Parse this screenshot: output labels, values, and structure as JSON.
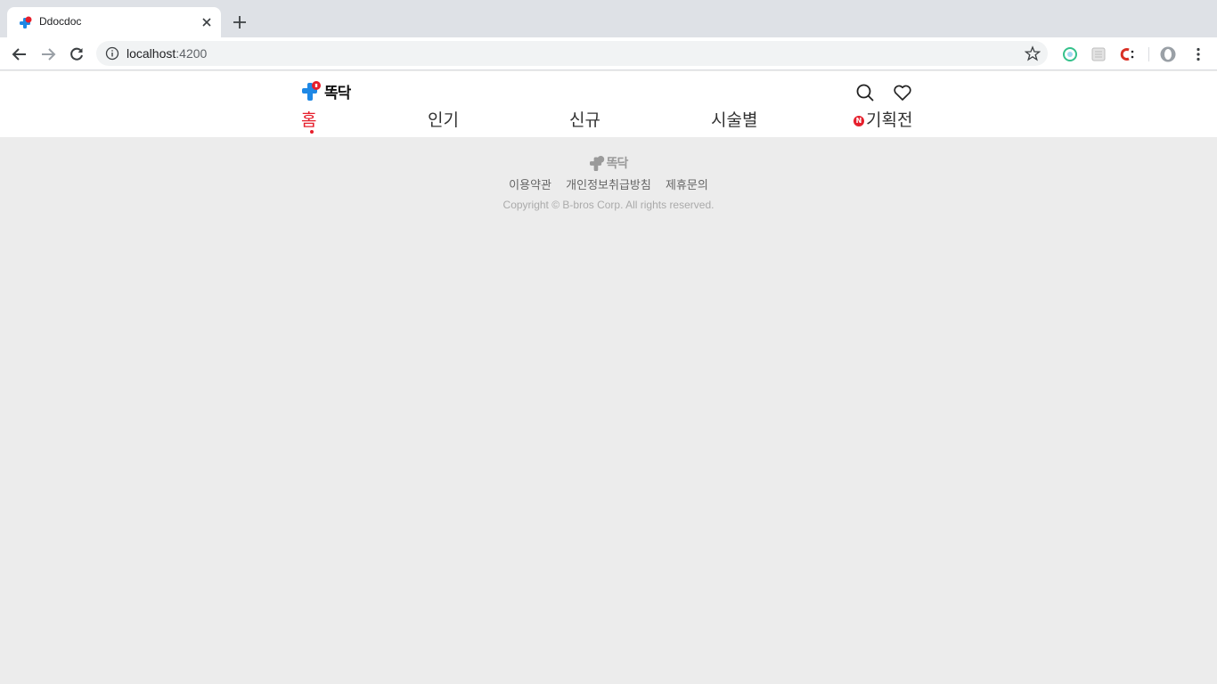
{
  "browser": {
    "tab_title": "Ddocdoc",
    "url_host": "localhost",
    "url_port": ":4200"
  },
  "site": {
    "logo_text": "똑닥",
    "menu": [
      {
        "label": "홈",
        "active": true
      },
      {
        "label": "인기",
        "active": false
      },
      {
        "label": "신규",
        "active": false
      },
      {
        "label": "시술별",
        "active": false
      },
      {
        "label": "기획전",
        "active": false,
        "badge": "N"
      }
    ],
    "icons": [
      "search-icon",
      "heart-icon"
    ],
    "accent_color": "#e61e2b"
  },
  "footer": {
    "logo_text": "똑닥",
    "links": [
      "이용약관",
      "개인정보취급방침",
      "제휴문의"
    ],
    "copyright": "Copyright © B-bros Corp. All rights reserved."
  }
}
